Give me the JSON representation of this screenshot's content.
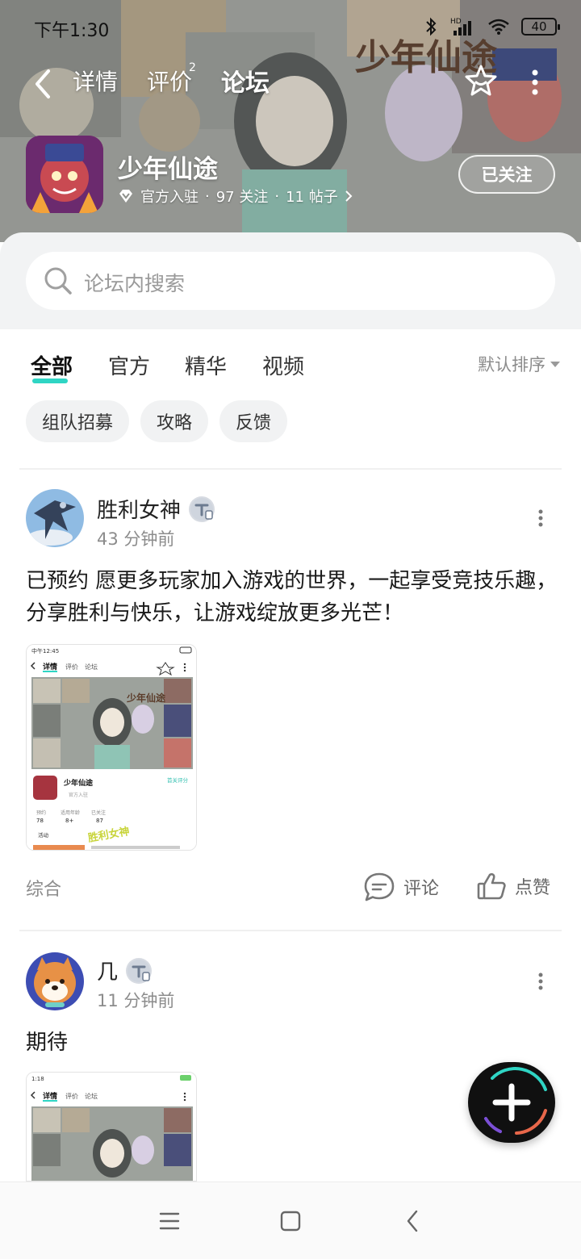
{
  "status_bar": {
    "time": "下午1:30",
    "hd": "HD",
    "battery": "40"
  },
  "nav": {
    "tabs": [
      {
        "label": "详情"
      },
      {
        "label": "评价",
        "badge": "2"
      },
      {
        "label": "论坛"
      }
    ],
    "active_tab": "论坛"
  },
  "header": {
    "banner_text": "少年仙途",
    "game_title": "少年仙途",
    "official": "官方入驻",
    "followers": "97 关注",
    "posts": "11 帖子",
    "follow_button": "已关注"
  },
  "search": {
    "placeholder": "论坛内搜索"
  },
  "filter_tabs": [
    "全部",
    "官方",
    "精华",
    "视频"
  ],
  "active_filter": "全部",
  "sort_label": "默认排序",
  "chips": [
    "组队招募",
    "攻略",
    "反馈"
  ],
  "posts": [
    {
      "author": "胜利女神",
      "time": "43 分钟前",
      "text": "已预约 愿更多玩家加入游戏的世界，一起享受竞技乐趣，分享胜利与快乐，让游戏绽放更多光芒！",
      "category": "综合",
      "comment_label": "评论",
      "like_label": "点赞",
      "thumb": {
        "status_time": "中午12:45",
        "tabs": [
          "详情",
          "评价",
          "论坛"
        ],
        "game_name": "少年仙途",
        "official": "官方入驻",
        "follow": "首关评分",
        "stats": [
          {
            "label": "预约",
            "value": "78"
          },
          {
            "label": "适用年龄",
            "value": "8+"
          },
          {
            "label": "已关注",
            "value": "87"
          }
        ],
        "activity": "活动",
        "watermark": "胜利女神"
      }
    },
    {
      "author": "几",
      "time": "11 分钟前",
      "text": "期待",
      "thumb": {
        "status_time": "1:18",
        "tabs": [
          "详情",
          "评价",
          "论坛"
        ]
      }
    }
  ]
}
